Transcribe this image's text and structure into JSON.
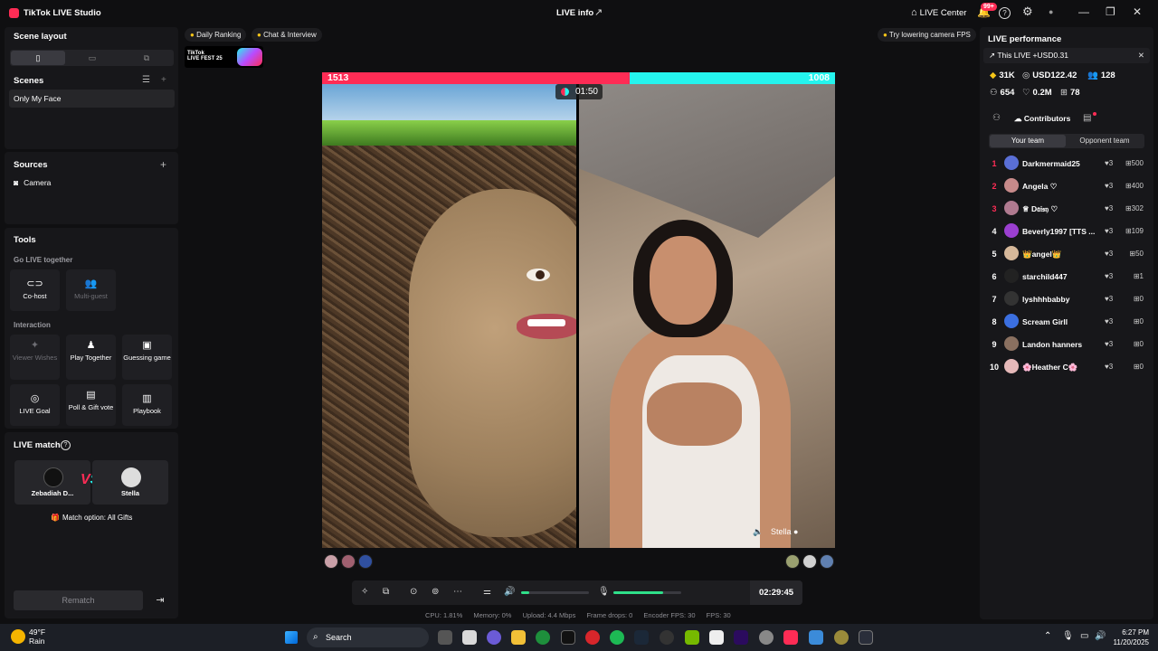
{
  "titlebar": {
    "app_title": "TikTok LIVE Studio",
    "center_title": "LIVE info",
    "live_center": "LIVE Center",
    "notif_badge": "99+"
  },
  "scene_layout": {
    "title": "Scene layout"
  },
  "scenes": {
    "title": "Scenes",
    "items": [
      "Only My Face"
    ]
  },
  "sources": {
    "title": "Sources",
    "items": [
      "Camera"
    ]
  },
  "tools": {
    "title": "Tools",
    "go_live_together": "Go LIVE together",
    "cohost": "Co-host",
    "multiguest": "Multi-guest",
    "interaction": "Interaction",
    "viewer_wishes": "Viewer Wishes",
    "play_together": "Play Together",
    "guessing_game": "Guessing game",
    "live_goal": "LIVE Goal",
    "poll_gift": "Poll & Gift vote",
    "playbook": "Playbook"
  },
  "live_match": {
    "title": "LIVE match",
    "player1": "Zebadiah D...",
    "player2": "Stella",
    "option": "Match option: All Gifts",
    "rematch": "Rematch"
  },
  "top_chips": {
    "daily_ranking": "Daily Ranking",
    "chat_interview": "Chat & Interview",
    "fps_tip": "Try lowering camera FPS"
  },
  "fest_banner": {
    "line1": "TikTok",
    "line2": "LIVE FEST 25"
  },
  "battle": {
    "left_score": "1513",
    "right_score": "1008",
    "timer": "01:50",
    "right_name": "Stella",
    "left_share": 0.6
  },
  "controls": {
    "live_time": "02:29:45",
    "speaker_level": 0.12,
    "mic_level": 0.73
  },
  "stats": {
    "cpu": "CPU: 1.81%",
    "memory": "Memory: 0%",
    "upload": "Upload: 4.4 Mbps",
    "frame_drops": "Frame drops: 0",
    "encoder_fps": "Encoder FPS: 30",
    "fps": "FPS: 30"
  },
  "performance": {
    "title": "LIVE performance",
    "this_live": "This LIVE +USD0.31",
    "diamonds": "31K",
    "usd": "USD122.42",
    "viewers": "128",
    "new_followers": "654",
    "likes": "0.2M",
    "gifters": "78"
  },
  "contributors": {
    "title": "Contributors",
    "your_team": "Your team",
    "opponent_team": "Opponent team",
    "rows": [
      {
        "rank": "1",
        "name": "Darkmermaid25",
        "likes": "3",
        "points": "500",
        "color": "#5a6fd6"
      },
      {
        "rank": "2",
        "name": "Angela ♡",
        "likes": "3",
        "points": "400",
        "color": "#c78a8a"
      },
      {
        "rank": "3",
        "name": "♕ D𝔞𝔦𝔰𝔶 ♡",
        "likes": "3",
        "points": "302",
        "color": "#b07a90"
      },
      {
        "rank": "4",
        "name": "Beverly1997 [TTS ...",
        "likes": "3",
        "points": "109",
        "color": "#9b3fd0"
      },
      {
        "rank": "5",
        "name": "👑angel👑",
        "likes": "3",
        "points": "50",
        "color": "#d6b89a"
      },
      {
        "rank": "6",
        "name": "starchild447",
        "likes": "3",
        "points": "1",
        "color": "#222222"
      },
      {
        "rank": "7",
        "name": "lyshhhbabby",
        "likes": "3",
        "points": "0",
        "color": "#333333"
      },
      {
        "rank": "8",
        "name": "Scream Girll",
        "likes": "3",
        "points": "0",
        "color": "#3b6fe0"
      },
      {
        "rank": "9",
        "name": "Landon hanners",
        "likes": "3",
        "points": "0",
        "color": "#8a7060"
      },
      {
        "rank": "10",
        "name": "🌸Heather C🌸",
        "likes": "3",
        "points": "0",
        "color": "#e6b9b9"
      }
    ]
  },
  "taskbar": {
    "temp": "49°F",
    "weather": "Rain",
    "search": "Search",
    "time": "6:27 PM",
    "date": "11/20/2025"
  }
}
